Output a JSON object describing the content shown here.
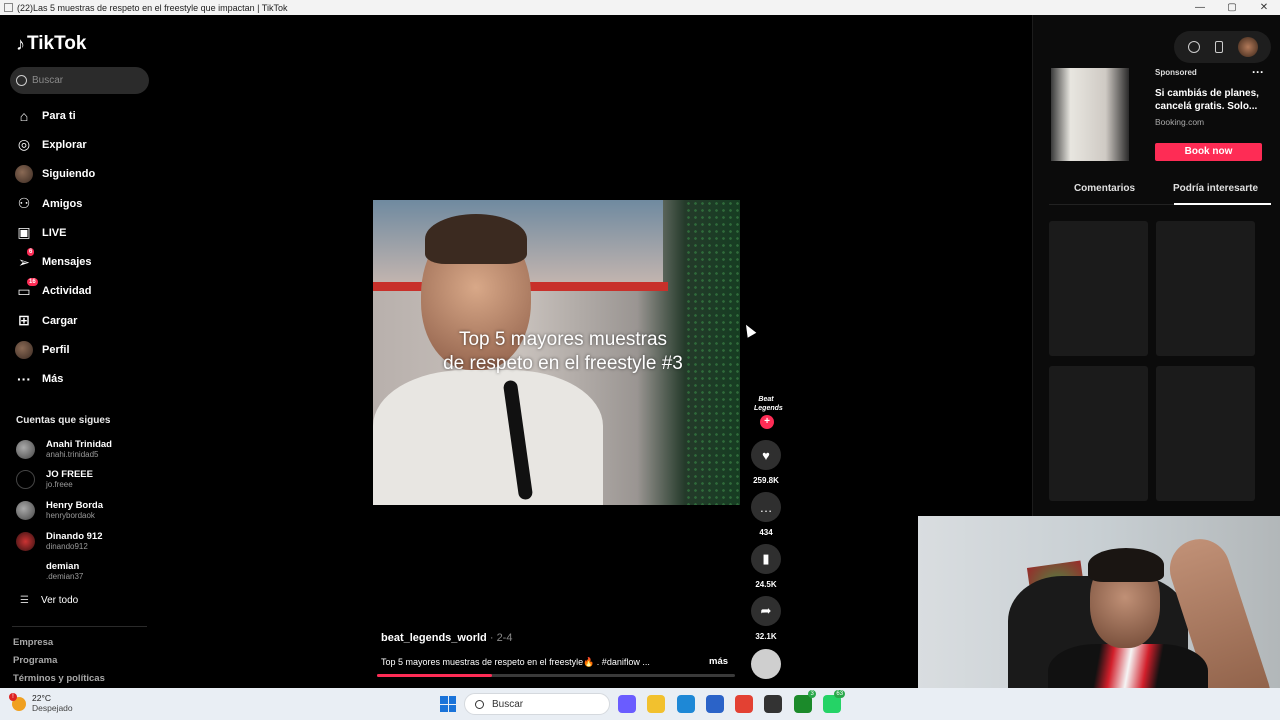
{
  "window": {
    "title": "(22)Las 5 muestras de respeto en el freestyle que impactan | TikTok",
    "controls": [
      "—",
      "▢",
      "✕"
    ]
  },
  "brand": {
    "name": "TikTok"
  },
  "search": {
    "placeholder": "Buscar"
  },
  "nav": [
    {
      "label": "Para ti",
      "icon": "home-icon"
    },
    {
      "label": "Explorar",
      "icon": "compass-icon"
    },
    {
      "label": "Siguiendo",
      "icon": "avatar"
    },
    {
      "label": "Amigos",
      "icon": "friends-icon"
    },
    {
      "label": "LIVE",
      "icon": "live-icon"
    },
    {
      "label": "Mensajes",
      "icon": "messages-icon",
      "badge": "6"
    },
    {
      "label": "Actividad",
      "icon": "activity-icon",
      "badge": "16"
    },
    {
      "label": "Cargar",
      "icon": "upload-icon"
    },
    {
      "label": "Perfil",
      "icon": "avatar"
    },
    {
      "label": "Más",
      "icon": "more-icon"
    }
  ],
  "following": {
    "title": "Cuentas que sigues",
    "accounts": [
      {
        "name": "Anahi Trinidad",
        "handle": "anahi.trinidad5"
      },
      {
        "name": "JO FREEE",
        "handle": "jo.freee"
      },
      {
        "name": "Henry Borda",
        "handle": "henrybordaok"
      },
      {
        "name": "Dinando 912",
        "handle": "dinando912"
      },
      {
        "name": "demian",
        "handle": ".demian37"
      }
    ],
    "see_all": "Ver todo"
  },
  "footer_links": [
    "Empresa",
    "Programa",
    "Términos y políticas"
  ],
  "video": {
    "caption_line1": "Top 5 mayores muestras",
    "caption_line2": "de respeto en el freestyle #3",
    "author": "beat_legends_world",
    "date": "2-4",
    "description": "Top 5 mayores muestras de respeto en el freestyle🔥 . #daniflow ...",
    "more": "más",
    "progress": 0.32
  },
  "actions": {
    "creator_avatar_text": "Beat Legends",
    "likes": "259.8K",
    "comments": "434",
    "saves": "24.5K",
    "shares": "32.1K"
  },
  "ad": {
    "label": "Sponsored",
    "title": "Si cambiás de planes, cancelá gratis. Solo...",
    "domain": "Booking.com",
    "cta": "Book now"
  },
  "tabs": [
    {
      "label": "Comentarios",
      "active": false
    },
    {
      "label": "Podría interesarte",
      "active": true
    }
  ],
  "taskbar": {
    "temperature": "22°C",
    "condition": "Despejado",
    "search_label": "Buscar",
    "apps": [
      {
        "name": "copilot-app",
        "color": "#6a5cff"
      },
      {
        "name": "explorer-app",
        "color": "#f2c12e"
      },
      {
        "name": "edge-app",
        "color": "#1e88d6"
      },
      {
        "name": "store-app",
        "color": "#2b63c8"
      },
      {
        "name": "chrome-app",
        "color": "#e34133"
      },
      {
        "name": "chrome-profile-app",
        "color": "#333333"
      },
      {
        "name": "xbox-app",
        "color": "#1b8a2a",
        "badge": "3"
      },
      {
        "name": "whatsapp-app",
        "color": "#25d366",
        "badge": "63"
      }
    ]
  }
}
